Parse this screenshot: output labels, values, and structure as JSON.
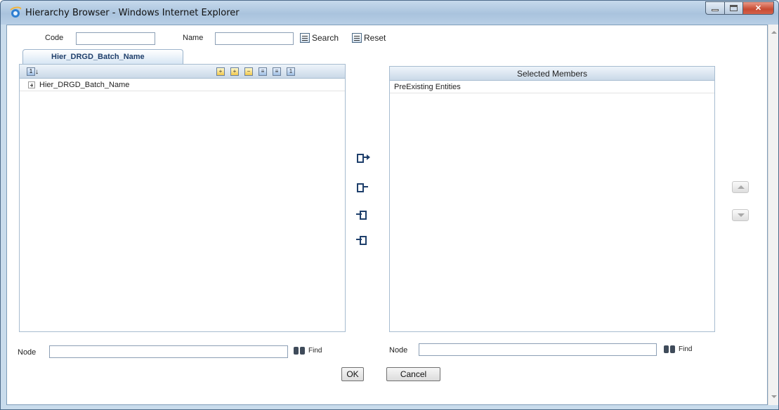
{
  "window": {
    "title": "Hierarchy Browser - Windows Internet Explorer"
  },
  "search": {
    "code_label": "Code",
    "code_value": "",
    "name_label": "Name",
    "name_value": "",
    "search_label": "Search",
    "reset_label": "Reset"
  },
  "tab": {
    "label": "Hier_DRGD_Batch_Name"
  },
  "left_panel": {
    "toolbar_icons": [
      "sort-numeric-icon",
      "expand-icon",
      "expand-branch-icon",
      "collapse-branch-icon",
      "show-code-icon",
      "show-name-icon",
      "level-icon"
    ],
    "tree": [
      {
        "label": "Hier_DRGD_Batch_Name",
        "expanded": false
      }
    ]
  },
  "right_panel": {
    "header": "Selected Members",
    "items": [
      "PreExisting Entities"
    ]
  },
  "move_buttons": [
    "select-icon",
    "select-all-icon",
    "deselect-icon",
    "deselect-all-icon"
  ],
  "order_buttons": [
    "move-up-icon",
    "move-down-icon"
  ],
  "left_find": {
    "node_label": "Node",
    "node_value": "",
    "find_label": "Find"
  },
  "right_find": {
    "node_label": "Node",
    "node_value": "",
    "find_label": "Find"
  },
  "footer": {
    "ok_label": "OK",
    "cancel_label": "Cancel"
  },
  "colors": {
    "tab_text": "#1f3f6b",
    "panel_border": "#a7bcd0",
    "title_bar": "#b8cfe6",
    "close_button": "#c74a32"
  }
}
